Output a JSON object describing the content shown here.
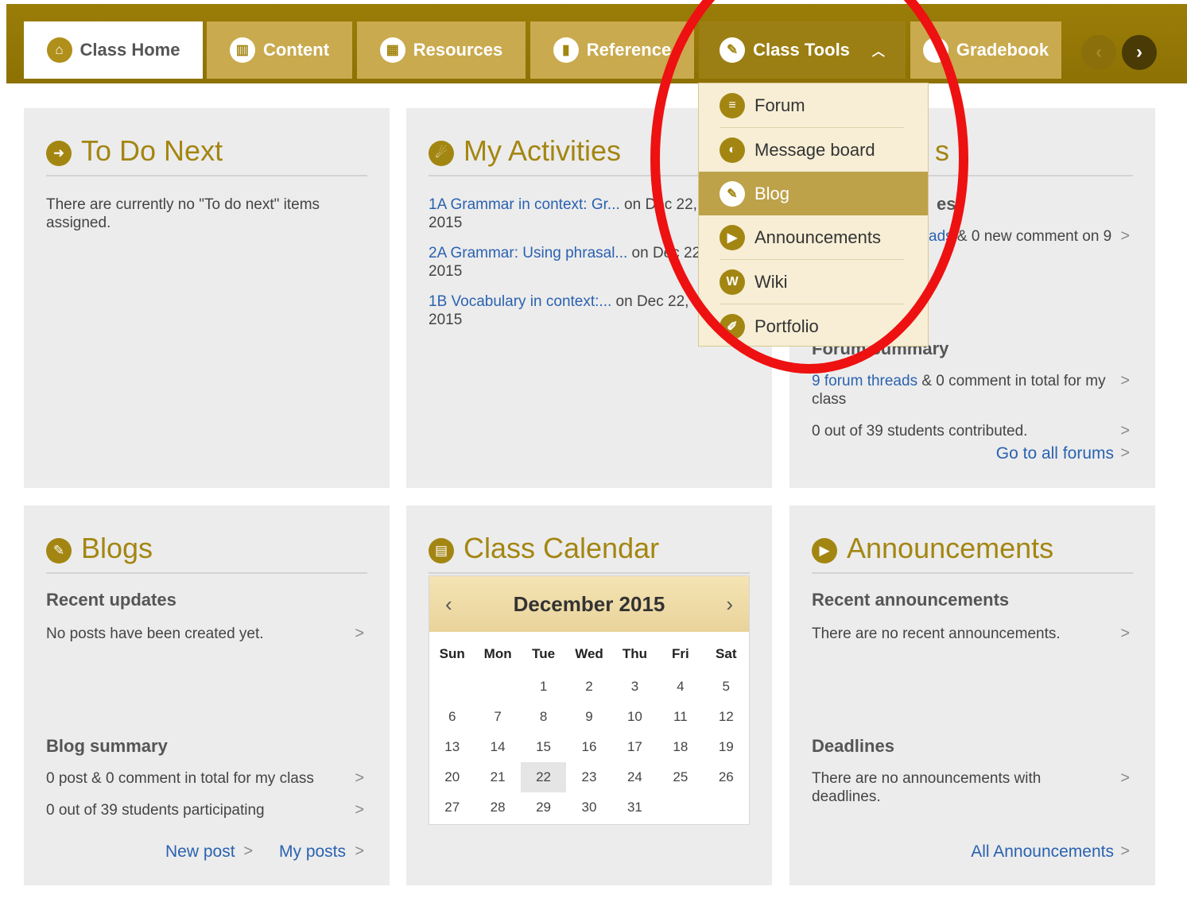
{
  "tabs": [
    {
      "label": "Class Home",
      "icon": "home-icon"
    },
    {
      "label": "Content",
      "icon": "book-icon"
    },
    {
      "label": "Resources",
      "icon": "grid-icon"
    },
    {
      "label": "Reference",
      "icon": "bookmark-icon"
    },
    {
      "label": "Class Tools",
      "icon": "wrench-icon"
    },
    {
      "label": "Gradebook",
      "icon": "chart-icon"
    }
  ],
  "dropdown": [
    {
      "label": "Forum",
      "icon": "forum-icon"
    },
    {
      "label": "Message board",
      "icon": "message-board-icon"
    },
    {
      "label": "Blog",
      "icon": "blog-icon"
    },
    {
      "label": "Announcements",
      "icon": "announcement-icon"
    },
    {
      "label": "Wiki",
      "icon": "wiki-icon"
    },
    {
      "label": "Portfolio",
      "icon": "portfolio-icon"
    }
  ],
  "todo": {
    "title": "To Do Next",
    "text": "There are currently no \"To do next\" items assigned."
  },
  "activities": {
    "title": "My Activities",
    "items": [
      {
        "link": "1A Grammar in context: Gr...",
        "date": "on Dec 22,",
        "year": "2015"
      },
      {
        "link": "2A Grammar: Using phrasal...",
        "date": "on Dec 22,",
        "year": "2015"
      },
      {
        "link": "1B Vocabulary in context:...",
        "date": "on Dec 22,",
        "year": "2015"
      }
    ]
  },
  "forums": {
    "title_fragment": "s",
    "sub1_fragment": "es",
    "row1_link": "ads",
    "row1_text": "& 0 new comment on 9",
    "summary_title": "Forum summary",
    "threads_link": "9 forum threads",
    "threads_text": "& 0 comment in total for my class",
    "contributed": "0 out of 39 students contributed.",
    "go_all": "Go to all forums"
  },
  "blogs": {
    "title": "Blogs",
    "recent": "Recent updates",
    "none": "No posts have been created yet.",
    "summary": "Blog summary",
    "total": "0 post & 0 comment in total for my class",
    "participating": "0 out of 39 students participating",
    "new_post": "New post",
    "my_posts": "My posts"
  },
  "calendar": {
    "title": "Class Calendar",
    "month": "December 2015",
    "days": [
      "Sun",
      "Mon",
      "Tue",
      "Wed",
      "Thu",
      "Fri",
      "Sat"
    ],
    "weeks": [
      [
        "",
        "",
        "1",
        "2",
        "3",
        "4",
        "5"
      ],
      [
        "6",
        "7",
        "8",
        "9",
        "10",
        "11",
        "12"
      ],
      [
        "13",
        "14",
        "15",
        "16",
        "17",
        "18",
        "19"
      ],
      [
        "20",
        "21",
        "22",
        "23",
        "24",
        "25",
        "26"
      ],
      [
        "27",
        "28",
        "29",
        "30",
        "31",
        "",
        ""
      ]
    ],
    "today": "22"
  },
  "announcements": {
    "title": "Announcements",
    "recent": "Recent announcements",
    "none": "There are no recent announcements.",
    "deadlines": "Deadlines",
    "no_deadlines": "There are no announcements with deadlines.",
    "all": "All Announcements"
  },
  "colors": {
    "accent": "#a38612",
    "tab": "#c9aa4e",
    "link": "#2a62b0",
    "highlight": "#ee1111"
  }
}
